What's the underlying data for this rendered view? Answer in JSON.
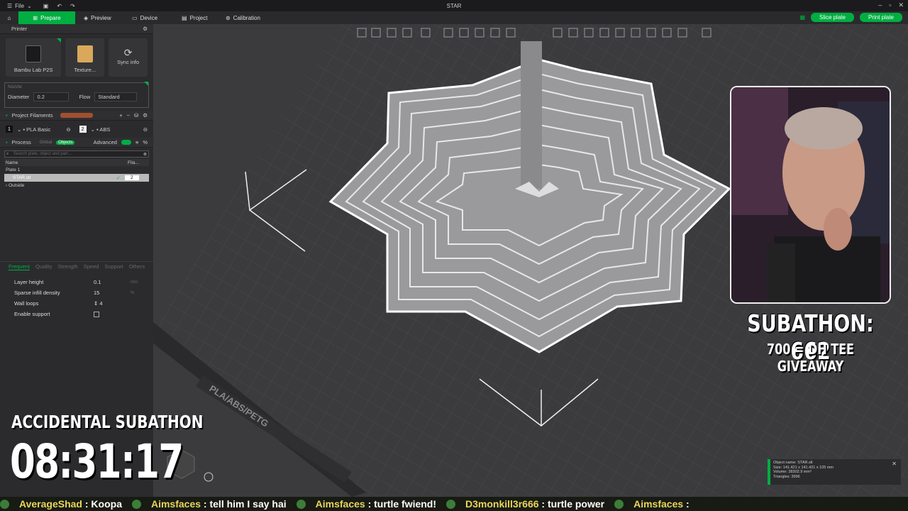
{
  "titlebar": {
    "file_menu": "File",
    "title": "STAR"
  },
  "topbar": {
    "tabs": [
      {
        "label": "Prepare"
      },
      {
        "label": "Preview"
      },
      {
        "label": "Device"
      },
      {
        "label": "Project"
      },
      {
        "label": "Calibration"
      }
    ],
    "slice_label": "Slice plate",
    "print_label": "Print plate"
  },
  "sidebar": {
    "printer_header": "Printer",
    "printer_name": "Bambu Lab P2S",
    "plate_type": "Texture...",
    "sync_label": "Sync info",
    "nozzle_label": "Nozzle",
    "diameter_label": "Diameter",
    "diameter_value": "0.2",
    "flow_label": "Flow",
    "flow_value": "Standard",
    "filaments_header": "Project Filaments",
    "filaments": [
      {
        "index": "1",
        "name": "PLA Basic"
      },
      {
        "index": "2",
        "name": "ABS"
      }
    ],
    "process_header": "Process",
    "global_label": "Global",
    "objects_label": "Objects",
    "advanced_label": "Advanced",
    "search_placeholder": "Search plate, object and part...",
    "tree_name_col": "Name",
    "tree_fila_col": "Fila...",
    "tree_items": [
      {
        "label": "Plate 1"
      },
      {
        "label": "STAR.stl",
        "fila": "2"
      },
      {
        "label": "Outside"
      }
    ],
    "prop_tabs": [
      "Frequent",
      "Quality",
      "Strength",
      "Speed",
      "Support",
      "Others"
    ],
    "props": [
      {
        "label": "Layer height",
        "value": "0.1",
        "unit": "mm"
      },
      {
        "label": "Sparse infill density",
        "value": "15",
        "unit": "%"
      },
      {
        "label": "Wall loops",
        "value": "4",
        "unit": ""
      },
      {
        "label": "Enable support",
        "value": "",
        "unit": ""
      }
    ]
  },
  "plate": {
    "label": "PLA/ABS/PETG"
  },
  "overlay": {
    "subathon_count": "SUBATHON: 662",
    "subathon_goal": "700 = DH TEE GIVEAWAY",
    "accidental_label": "ACCIDENTAL SUBATHON",
    "timer": "08:31:17"
  },
  "object_info": {
    "name": "Object name: STAR.stl",
    "size": "Size: 141.421 x 141.421 x 105 mm",
    "volume": "Volume: 38302.9 mm³",
    "triangles": "Triangles: 3996"
  },
  "chat": [
    {
      "user": "AverageShad",
      "msg": "Koopa"
    },
    {
      "user": "Aimsfaces",
      "msg": "tell him I say hai"
    },
    {
      "user": "Aimsfaces",
      "msg": "turtle fwiend!"
    },
    {
      "user": "D3monkill3r666",
      "msg": "turtle power"
    },
    {
      "user": "Aimsfaces",
      "msg": ""
    }
  ],
  "colors": {
    "accent": "#00ae42",
    "viewport": "#3b3b3e",
    "sidebar": "#2b2b2e"
  }
}
